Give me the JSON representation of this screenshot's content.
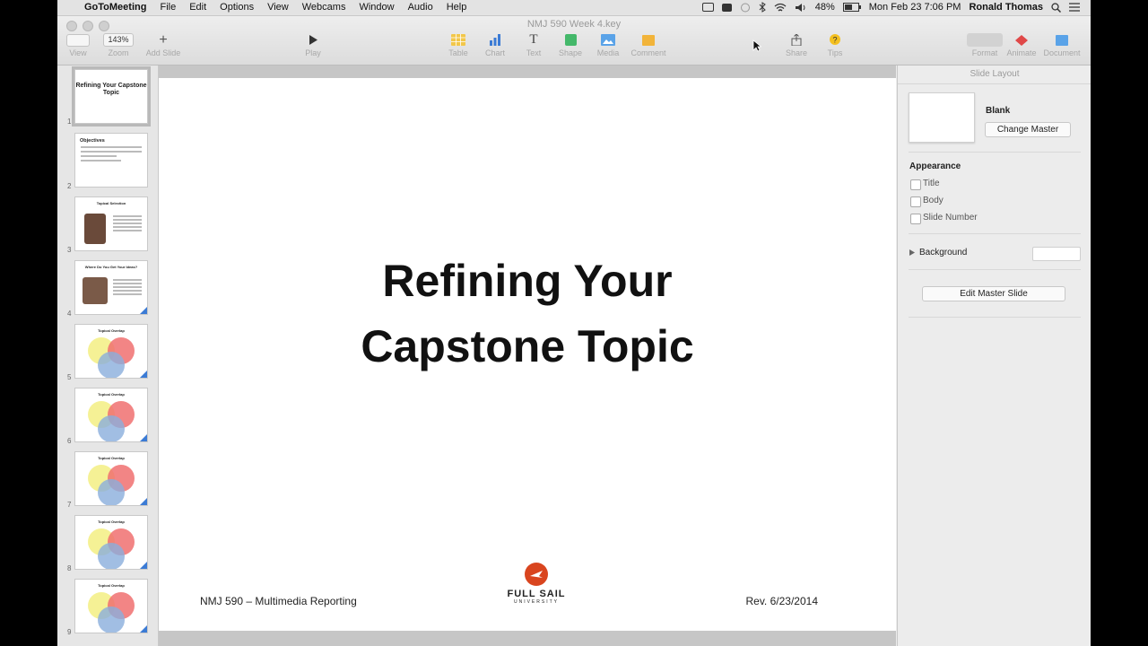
{
  "menubar": {
    "apple": "",
    "app": "GoToMeeting",
    "items": [
      "File",
      "Edit",
      "Options",
      "View",
      "Webcams",
      "Window",
      "Audio",
      "Help"
    ],
    "battery": "48%",
    "datetime": "Mon Feb 23  7:06 PM",
    "user": "Ronald Thomas"
  },
  "window": {
    "title": "NMJ 590 Week 4.key"
  },
  "toolbar": {
    "view_label": "View",
    "zoom_value": "143%",
    "zoom_label": "Zoom",
    "add_slide_label": "Add Slide",
    "play_label": "Play",
    "table_label": "Table",
    "chart_label": "Chart",
    "text_label": "Text",
    "shape_label": "Shape",
    "media_label": "Media",
    "comment_label": "Comment",
    "share_label": "Share",
    "tips_label": "Tips",
    "format_label": "Format",
    "animate_label": "Animate",
    "document_label": "Document"
  },
  "navigator": {
    "slides": [
      {
        "num": "1",
        "title": "Refining Your Capstone Topic"
      },
      {
        "num": "2",
        "title": "Objectives"
      },
      {
        "num": "3",
        "title": "Topical Selection"
      },
      {
        "num": "4",
        "title": "Where Do You Get Your Ideas?"
      },
      {
        "num": "5",
        "title": "Topical Overlap"
      },
      {
        "num": "6",
        "title": "Topical Overlap"
      },
      {
        "num": "7",
        "title": "Topical Overlap"
      },
      {
        "num": "8",
        "title": "Topical Overlap"
      },
      {
        "num": "9",
        "title": "Topical Overlap"
      }
    ]
  },
  "slide": {
    "title_line1": "Refining Your",
    "title_line2": "Capstone Topic",
    "footer_left": "NMJ 590 – Multimedia Reporting",
    "footer_right": "Rev. 6/23/2014",
    "logo_text": "FULL SAIL",
    "logo_sub": "UNIVERSITY"
  },
  "inspector": {
    "tab": "Slide Layout",
    "master_name": "Blank",
    "change_master": "Change Master",
    "appearance": "Appearance",
    "checkboxes": [
      "Title",
      "Body",
      "Slide Number"
    ],
    "background": "Background",
    "edit_master": "Edit Master Slide"
  },
  "colors": {
    "accent_blue": "#3b7bd5",
    "logo_orange": "#d9451f",
    "venn_yellow": "#f4f08a",
    "venn_red": "#f07070",
    "venn_blue": "#8aaedc"
  }
}
